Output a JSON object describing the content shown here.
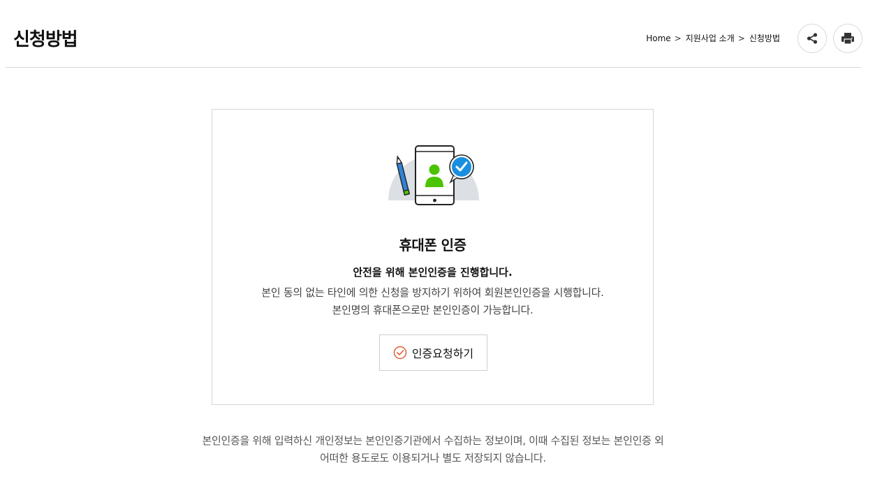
{
  "header": {
    "title": "신청방법",
    "breadcrumb": {
      "home": "Home",
      "section": "지원사업 소개",
      "current": "신청방법",
      "separator": ">"
    }
  },
  "toolbar": {
    "share_icon": "share-icon",
    "print_icon": "print-icon"
  },
  "auth_card": {
    "title": "휴대폰 인증",
    "headline": "안전을 위해 본인인증을 진행합니다.",
    "desc_line1": "본인 동의 없는 타인에 의한 신청을 방지하기 위하여 회원본인인증을 시행합니다.",
    "desc_line2": "본인명의 휴대폰으로만 본인인증이 가능합니다.",
    "button_label": "인증요청하기",
    "button_icon": "check-circle-icon",
    "illustration_icon": "phone-verification-icon"
  },
  "notice": {
    "line1": "본인인증을 위해 입력하신 개인정보는 본인인증기관에서 수집하는 정보이며, 이때 수집된 정보는 본인인증 외",
    "line2": "어떠한 용도로도 이용되거나 별도 저장되지 않습니다."
  },
  "colors": {
    "accent_green": "#4cc300",
    "accent_blue": "#1a8fe0",
    "check_orange": "#e0603a",
    "border": "#d6d6d6"
  }
}
